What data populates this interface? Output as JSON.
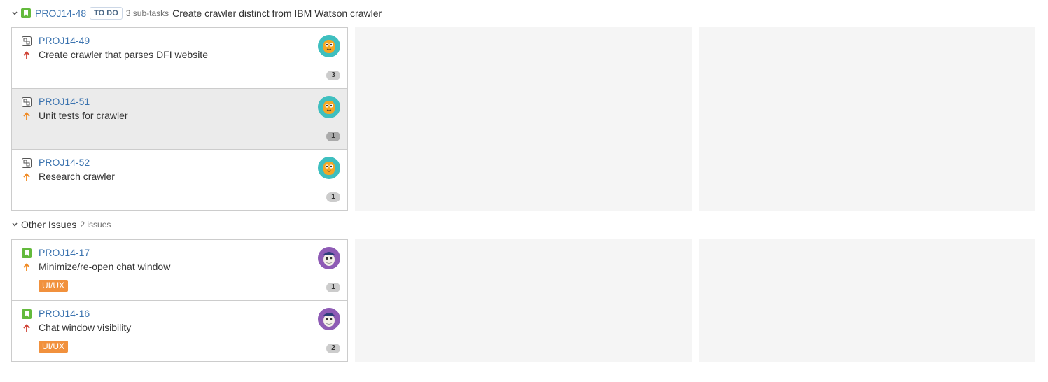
{
  "parent_swimlane": {
    "key": "PROJ14-48",
    "status": "TO DO",
    "subtask_count": "3 sub-tasks",
    "summary": "Create crawler distinct from IBM Watson crawler",
    "cards": [
      {
        "key": "PROJ14-49",
        "summary": "Create crawler that parses DFI website",
        "priority": "high",
        "count": "3",
        "type_icon": "subtask-icon",
        "avatar": "orange-monster-avatar"
      },
      {
        "key": "PROJ14-51",
        "summary": "Unit tests for crawler",
        "priority": "medium",
        "count": "1",
        "type_icon": "subtask-icon",
        "avatar": "orange-monster-avatar"
      },
      {
        "key": "PROJ14-52",
        "summary": "Research crawler",
        "priority": "medium",
        "count": "1",
        "type_icon": "subtask-icon",
        "avatar": "orange-monster-avatar"
      }
    ]
  },
  "other_swimlane": {
    "title": "Other Issues",
    "count": "2 issues",
    "cards": [
      {
        "key": "PROJ14-17",
        "summary": "Minimize/re-open chat window",
        "priority": "medium",
        "count": "1",
        "label": "UI/UX",
        "type_icon": "story-icon",
        "avatar": "pirate-avatar"
      },
      {
        "key": "PROJ14-16",
        "summary": "Chat window visibility",
        "priority": "high",
        "count": "2",
        "label": "UI/UX",
        "type_icon": "story-icon",
        "avatar": "pirate-avatar"
      }
    ]
  },
  "colors": {
    "link": "#3b73af",
    "priority_high": "#d04437",
    "priority_medium": "#f08a24",
    "label_bg": "#f1913d",
    "story_green": "#63ba3c",
    "empty_column": "#f5f5f5",
    "selected_card": "#ebebeb"
  }
}
